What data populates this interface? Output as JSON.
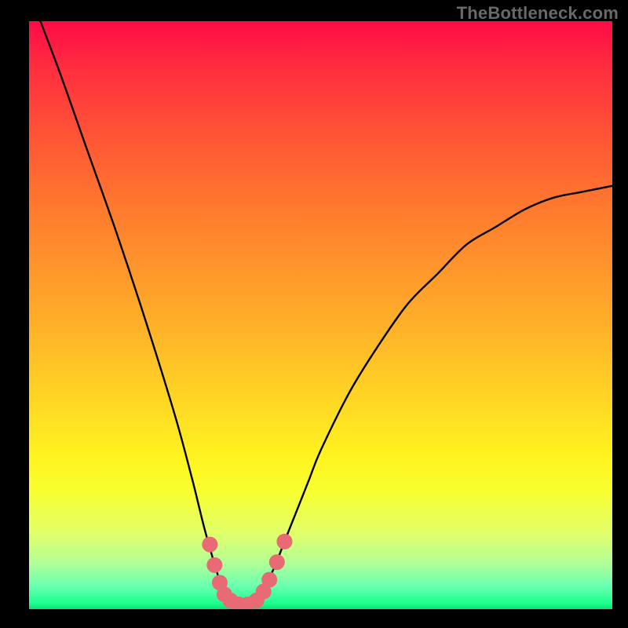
{
  "watermark": "TheBottleneck.com",
  "chart_data": {
    "type": "line",
    "title": "",
    "xlabel": "",
    "ylabel": "",
    "xlim": [
      0,
      100
    ],
    "ylim": [
      0,
      100
    ],
    "grid": false,
    "curve": {
      "name": "bottleneck-curve",
      "x": [
        0,
        5,
        10,
        15,
        20,
        25,
        28,
        30,
        32,
        33,
        34,
        35,
        36,
        37,
        38,
        40,
        42,
        44,
        46,
        48,
        50,
        55,
        60,
        65,
        70,
        75,
        80,
        85,
        90,
        95,
        100
      ],
      "y": [
        105,
        92,
        78,
        64,
        49,
        33,
        22,
        14,
        7,
        4,
        2,
        1,
        0,
        0,
        1,
        3,
        7,
        12,
        17,
        22,
        27,
        37,
        45,
        52,
        57,
        62,
        65,
        68,
        70,
        71,
        72
      ]
    },
    "markers": {
      "name": "highlighted-points",
      "color": "#e86a74",
      "points": [
        {
          "x": 31.0,
          "y": 11.0
        },
        {
          "x": 31.8,
          "y": 7.5
        },
        {
          "x": 32.7,
          "y": 4.5
        },
        {
          "x": 33.5,
          "y": 2.5
        },
        {
          "x": 34.5,
          "y": 1.5
        },
        {
          "x": 36.0,
          "y": 0.8
        },
        {
          "x": 37.5,
          "y": 0.8
        },
        {
          "x": 39.0,
          "y": 1.5
        },
        {
          "x": 40.2,
          "y": 3.0
        },
        {
          "x": 41.2,
          "y": 5.0
        },
        {
          "x": 42.5,
          "y": 8.0
        },
        {
          "x": 43.8,
          "y": 11.5
        }
      ]
    },
    "gradient_stops": [
      {
        "pos": 0,
        "color": "#ff0b46"
      },
      {
        "pos": 50,
        "color": "#ffc626"
      },
      {
        "pos": 80,
        "color": "#fbff2d"
      },
      {
        "pos": 100,
        "color": "#05e36d"
      }
    ]
  }
}
